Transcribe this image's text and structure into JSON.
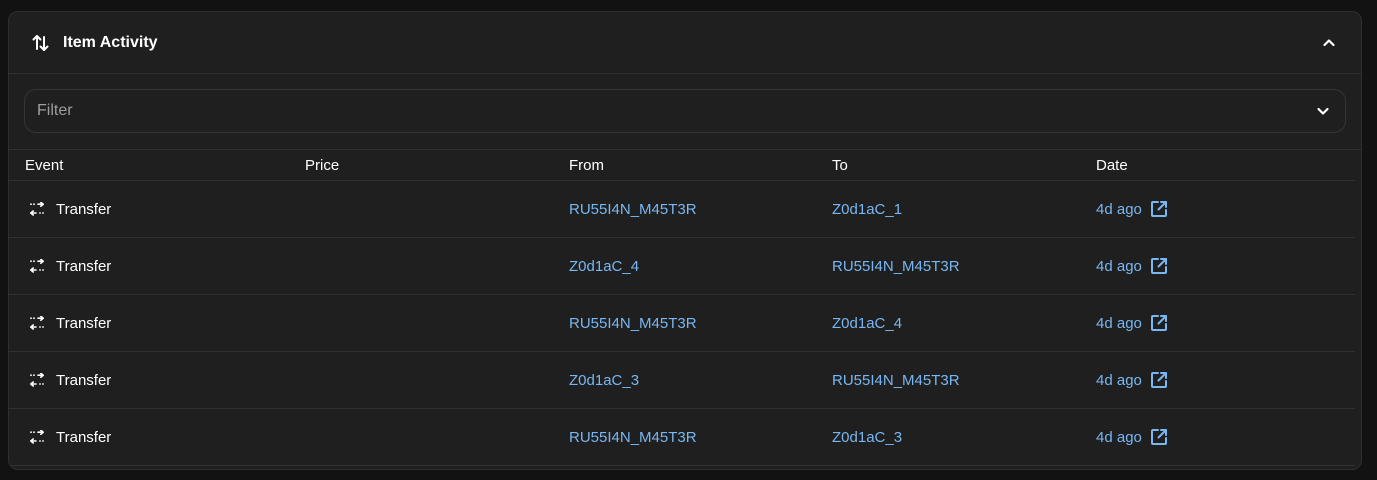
{
  "panel": {
    "title": "Item Activity",
    "title_icon": "arrows-up-down-icon",
    "collapse_icon": "chevron-up-icon"
  },
  "filter": {
    "placeholder": "Filter",
    "icon": "chevron-down-icon"
  },
  "table": {
    "columns": [
      "Event",
      "Price",
      "From",
      "To",
      "Date"
    ],
    "rows": [
      {
        "event": "Transfer",
        "price": "",
        "from": "RU55I4N_M45T3R",
        "to": "Z0d1aC_1",
        "date": "4d ago"
      },
      {
        "event": "Transfer",
        "price": "",
        "from": "Z0d1aC_4",
        "to": "RU55I4N_M45T3R",
        "date": "4d ago"
      },
      {
        "event": "Transfer",
        "price": "",
        "from": "RU55I4N_M45T3R",
        "to": "Z0d1aC_4",
        "date": "4d ago"
      },
      {
        "event": "Transfer",
        "price": "",
        "from": "Z0d1aC_3",
        "to": "RU55I4N_M45T3R",
        "date": "4d ago"
      },
      {
        "event": "Transfer",
        "price": "",
        "from": "RU55I4N_M45T3R",
        "to": "Z0d1aC_3",
        "date": "4d ago"
      }
    ]
  },
  "colors": {
    "background": "#121212",
    "panel": "#1f1f1f",
    "link": "#78b7f2",
    "text": "#ffffff"
  }
}
